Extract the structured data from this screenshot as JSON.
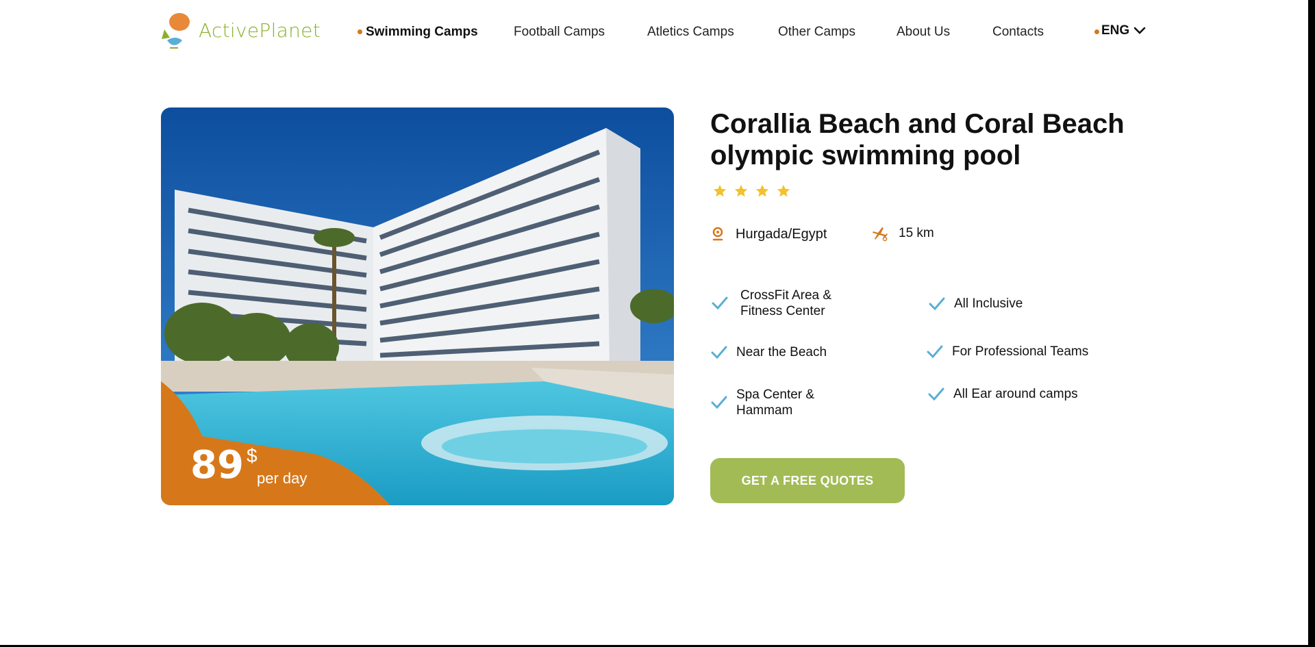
{
  "header": {
    "logo_text": "ActivePlanet",
    "nav": [
      {
        "label": "Swimming Camps",
        "active": true
      },
      {
        "label": "Football Camps",
        "active": false
      },
      {
        "label": "Atletics Camps",
        "active": false
      },
      {
        "label": "Other Camps",
        "active": false
      },
      {
        "label": "About Us",
        "active": false
      },
      {
        "label": "Contacts",
        "active": false
      }
    ],
    "language": "ENG"
  },
  "offer": {
    "price": "89",
    "currency": "$",
    "price_unit": "per day",
    "title_line1": "Corallia Beach and Coral Beach",
    "title_line2": "olympic swimming pool",
    "stars": 4,
    "location": "Hurgada/Egypt",
    "distance": "15 km",
    "features": [
      {
        "line1": "CrossFit Area &",
        "line2": "Fitness Center"
      },
      {
        "line1": "All Inclusive",
        "line2": ""
      },
      {
        "line1": "Near the Beach",
        "line2": ""
      },
      {
        "line1": "For Professional Teams",
        "line2": ""
      },
      {
        "line1": "Spa Center &",
        "line2": "Hammam"
      },
      {
        "line1": "All Ear around camps",
        "line2": ""
      }
    ],
    "cta_label": "GET A FREE QUOTES"
  },
  "colors": {
    "accent_orange": "#d6781a",
    "brand_green": "#8ab02a",
    "button_green": "#a3bb55",
    "check_blue": "#5aaed6",
    "star_yellow": "#f2c12e"
  }
}
